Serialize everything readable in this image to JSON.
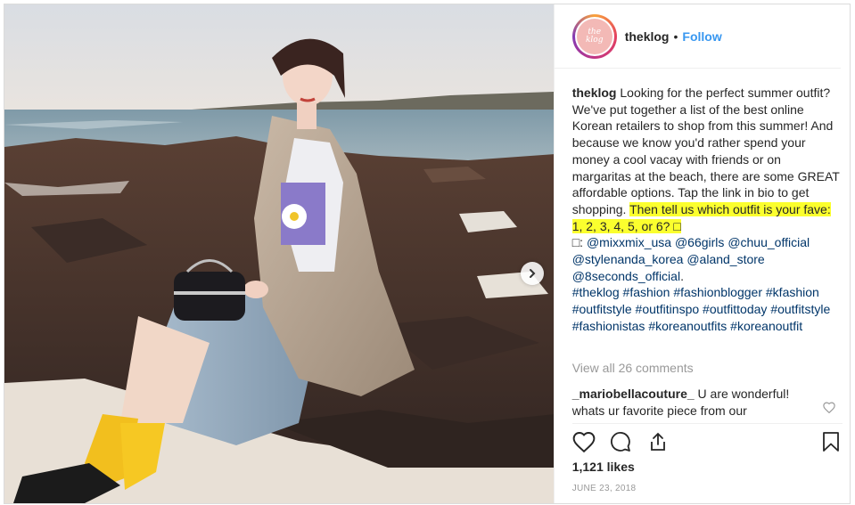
{
  "post": {
    "username": "theklog",
    "separator": "•",
    "follow_label": "Follow",
    "avatar_text_line1": "the",
    "avatar_text_line2": "klog"
  },
  "caption": {
    "username": "theklog",
    "text_plain": "Looking for the perfect summer outfit? We've put together a list of the best online Korean retailers to shop from this summer! And because we know you'd rather spend your money a cool vacay with friends or on margaritas at the beach, there are some GREAT affordable options. Tap the link in bio to get shopping.",
    "text_highlight": "Then tell us which outfit is your fave: 1, 2, 3, 4, 5, or 6? □",
    "mentions_prefix": "□: ",
    "mentions": [
      "@mixxmix_usa",
      "@66girls",
      "@chuu_official",
      "@stylenanda_korea",
      "@aland_store",
      "@8seconds_official"
    ],
    "mentions_suffix": ".",
    "hashtags": [
      "#theklog",
      "#fashion",
      "#fashionblogger",
      "#kfashion",
      "#outfitstyle",
      "#outfitinspo",
      "#outfittoday",
      "#outfitstyle",
      "#fashionistas",
      "#koreanoutfits",
      "#koreanoutfit"
    ]
  },
  "comments": {
    "view_all_label": "View all 26 comments",
    "items": [
      {
        "username": "_mariobellacouture_",
        "text": "U are wonderful! whats ur favorite piece from our"
      }
    ]
  },
  "actions": {
    "like_icon": "heart-icon",
    "comment_icon": "comment-icon",
    "share_icon": "share-icon",
    "save_icon": "bookmark-icon"
  },
  "likes_label": "1,121 likes",
  "date_label": "JUNE 23, 2018",
  "colors": {
    "link": "#3897f0",
    "tag": "#003569",
    "highlight": "#fbff2e",
    "muted": "#999999"
  }
}
